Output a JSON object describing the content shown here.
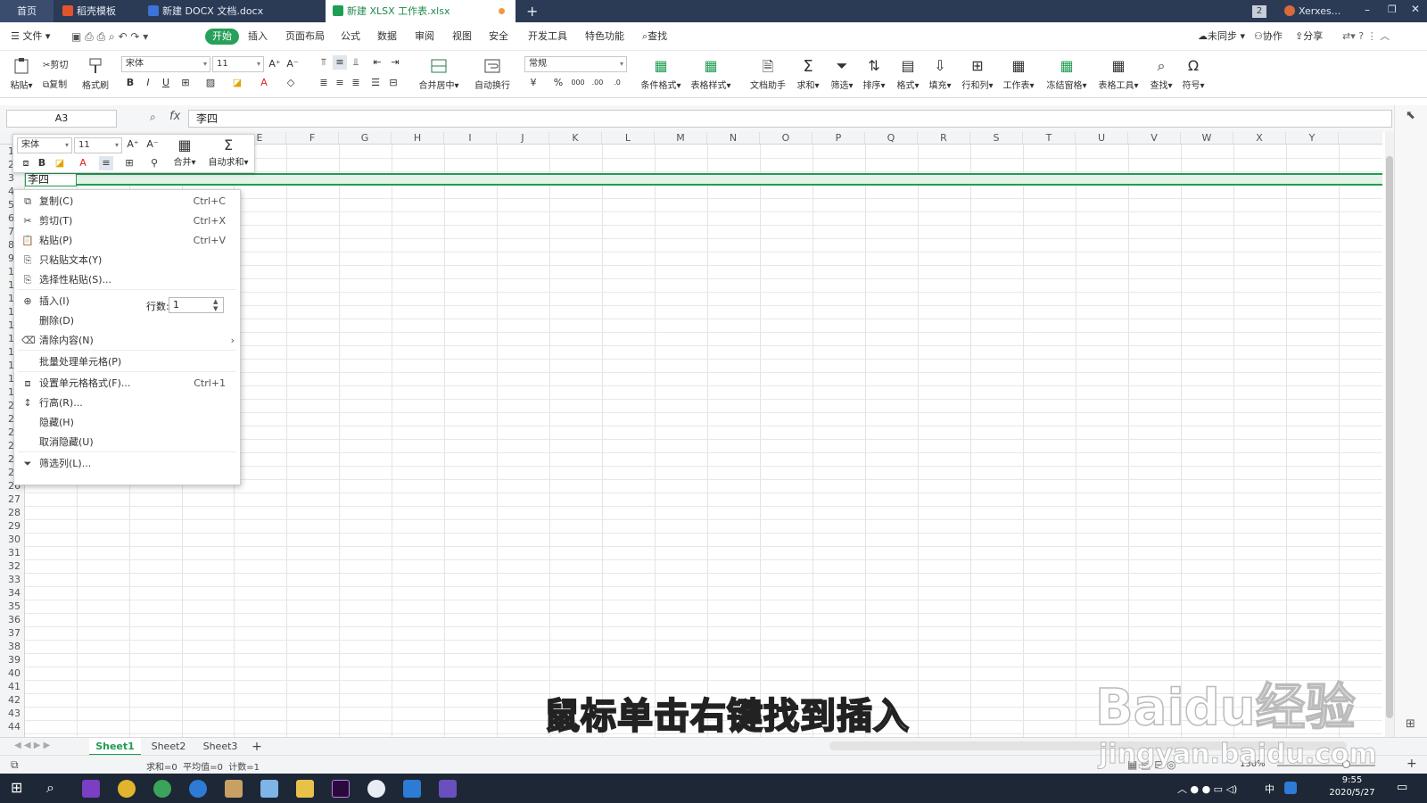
{
  "tabs": {
    "home": "首页",
    "t1": "稻壳模板",
    "t2": "新建 DOCX 文档.docx",
    "t3": "新建 XLSX 工作表.xlsx",
    "badge": "2",
    "user": "Xerxes..."
  },
  "menu": {
    "file": "文件",
    "items": [
      "开始",
      "插入",
      "页面布局",
      "公式",
      "数据",
      "审阅",
      "视图",
      "安全",
      "开发工具",
      "特色功能"
    ],
    "search": "查找",
    "sync": "未同步",
    "collab": "协作",
    "share": "分享"
  },
  "ribbon": {
    "paste": "粘贴",
    "cut": "剪切",
    "copy": "复制",
    "format_painter": "格式刷",
    "font": "宋体",
    "size": "11",
    "merge": "合并居中",
    "wrap": "自动换行",
    "numfmt": "常规",
    "buttons": [
      "条件格式",
      "表格样式",
      "文档助手",
      "求和",
      "筛选",
      "排序",
      "格式",
      "填充",
      "行和列",
      "工作表",
      "冻结窗格",
      "表格工具",
      "查找",
      "符号"
    ]
  },
  "formula": {
    "namebox": "A3",
    "fx": "fx",
    "value": "李四"
  },
  "grid": {
    "columns": [
      "E",
      "F",
      "G",
      "H",
      "I",
      "J",
      "K",
      "L",
      "M",
      "N",
      "O",
      "P",
      "Q",
      "R",
      "S",
      "T",
      "U",
      "V",
      "W",
      "X",
      "Y"
    ],
    "rows_top": [
      "1",
      "2",
      "3",
      "4",
      "5",
      "6",
      "7",
      "8",
      "9",
      "1",
      "1",
      "1",
      "1",
      "1",
      "1",
      "1",
      "1",
      "1",
      "1",
      "2",
      "2",
      "2",
      "2",
      "2",
      "2"
    ],
    "rows_bottom": [
      "26",
      "27",
      "28",
      "29",
      "30",
      "31",
      "32",
      "33",
      "34",
      "35",
      "36",
      "37",
      "38",
      "39",
      "40",
      "41",
      "42",
      "43",
      "44"
    ],
    "a3_value": "李四"
  },
  "mini_toolbar": {
    "font": "宋体",
    "size": "11",
    "merge": "合并",
    "autosum": "自动求和"
  },
  "context_menu": {
    "items": [
      {
        "label": "复制(C)",
        "shortcut": "Ctrl+C",
        "icon": "copy-icon"
      },
      {
        "label": "剪切(T)",
        "shortcut": "Ctrl+X",
        "icon": "scissors-icon"
      },
      {
        "label": "粘贴(P)",
        "shortcut": "Ctrl+V",
        "icon": "paste-icon"
      },
      {
        "label": "只粘贴文本(Y)",
        "shortcut": "",
        "icon": "paste-text-icon"
      },
      {
        "label": "选择性粘贴(S)...",
        "shortcut": "",
        "icon": "paste-special-icon"
      },
      {
        "label": "插入(I)",
        "shortcut": "",
        "icon": "insert-icon"
      },
      {
        "label": "删除(D)",
        "shortcut": "",
        "icon": ""
      },
      {
        "label": "清除内容(N)",
        "shortcut": "",
        "icon": "eraser-icon"
      },
      {
        "label": "批量处理单元格(P)",
        "shortcut": "",
        "icon": ""
      },
      {
        "label": "设置单元格格式(F)...",
        "shortcut": "Ctrl+1",
        "icon": "format-cells-icon"
      },
      {
        "label": "行高(R)...",
        "shortcut": "",
        "icon": "row-height-icon"
      },
      {
        "label": "隐藏(H)",
        "shortcut": "",
        "icon": ""
      },
      {
        "label": "取消隐藏(U)",
        "shortcut": "",
        "icon": ""
      },
      {
        "label": "筛选列(L)...",
        "shortcut": "",
        "icon": "filter-column-icon"
      }
    ],
    "rows_label": "行数:",
    "rows_value": "1"
  },
  "sheets": [
    "Sheet1",
    "Sheet2",
    "Sheet3"
  ],
  "status": {
    "summary": "求和=0  平均值=0  计数=1",
    "zoom": "130%"
  },
  "taskbar": {
    "time": "9:55",
    "date": "2020/5/27",
    "ime": "中"
  },
  "overlay": {
    "subtitle": "鼠标单击右键找到插入",
    "watermark": "Baidu经验",
    "watermark_url": "jingyan.baidu.com"
  },
  "colors": {
    "accent": "#1e9e52",
    "titlebar": "#2b3a55",
    "taskbar": "#1d2736"
  }
}
